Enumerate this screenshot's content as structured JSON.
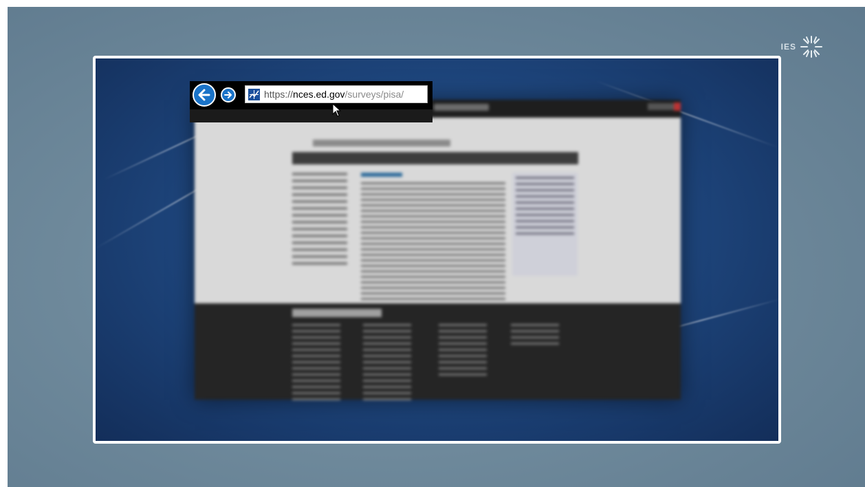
{
  "branding": {
    "logo_text": "IES",
    "logo_icon": "sunburst-icon"
  },
  "browser": {
    "back_icon": "back-arrow-icon",
    "forward_icon": "forward-arrow-icon",
    "favicon": "nces-favicon-icon",
    "url": {
      "scheme": "https://",
      "domain": "nces.ed.gov",
      "path": "/surveys/pisa/"
    }
  },
  "colors": {
    "frame_border": "#ffffff",
    "button_blue": "#1a73c8",
    "backdrop": "#6f8a9c"
  }
}
